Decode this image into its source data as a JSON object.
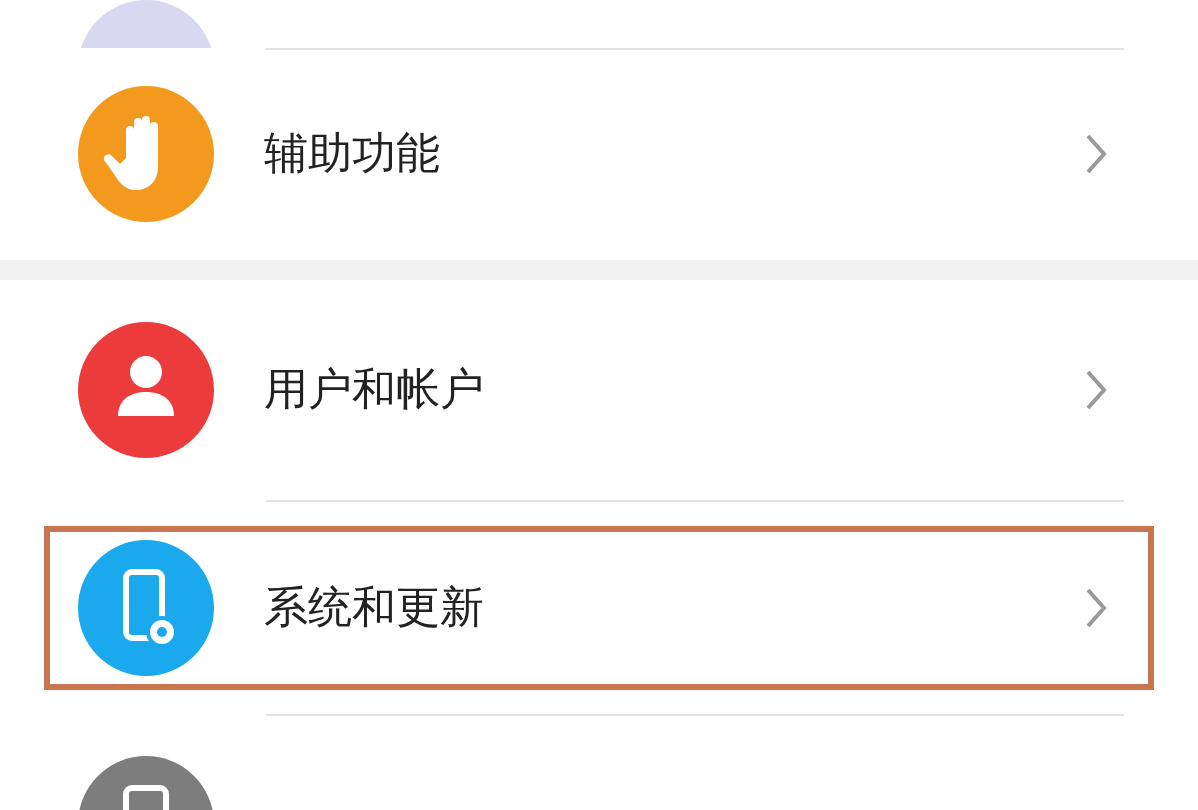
{
  "groups": [
    {
      "items": [
        {
          "kind": "circle_partial",
          "color": "#d8d8f0",
          "selected": false
        },
        {
          "kind": "hand",
          "color": "#f39a1e",
          "label": "辅助功能",
          "selected": false
        }
      ]
    },
    {
      "items": [
        {
          "kind": "user",
          "color": "#ec3b3b",
          "label": "用户和帐户",
          "selected": false
        },
        {
          "kind": "phone_gear",
          "color": "#1aa9ec",
          "label": "系统和更新",
          "selected": true
        },
        {
          "kind": "phone_partial",
          "color": "#7d7d7d",
          "selected": false
        }
      ]
    }
  ]
}
